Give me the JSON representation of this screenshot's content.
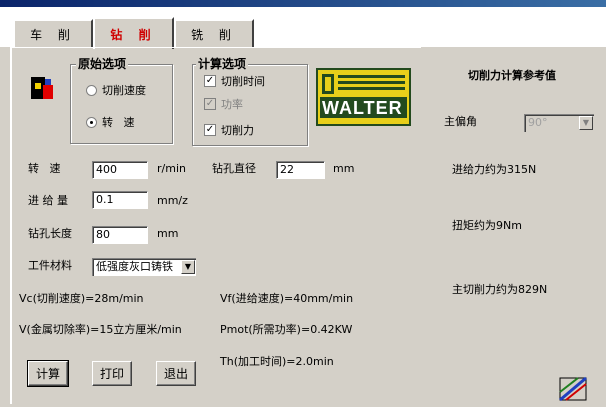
{
  "tabs": [
    {
      "label": "车 削"
    },
    {
      "label": "钻 削"
    },
    {
      "label": "铣 削"
    }
  ],
  "original_options": {
    "title": "原始选项",
    "radio1": "切削速度",
    "radio2": "转   速"
  },
  "calc_options": {
    "title": "计算选项",
    "check1": "切削时间",
    "check2": "功率",
    "check3": "切削力"
  },
  "logo_text": "WALTER",
  "fields": {
    "speed_label": "转   速",
    "speed_value": "400",
    "speed_unit": "r/min",
    "feed_label": "进 给 量",
    "feed_value": "0.1",
    "feed_unit": "mm/z",
    "depth_label": "钻孔长度",
    "depth_value": "80",
    "depth_unit": "mm",
    "diameter_label": "钻孔直径",
    "diameter_value": "22",
    "diameter_unit": "mm",
    "material_label": "工件材料",
    "material_value": "低强度灰口铸铁"
  },
  "results": {
    "vc": "Vc(切削速度)=28m/min",
    "vf": "Vf(进给速度)=40mm/min",
    "v": "V(金属切除率)=15立方厘米/min",
    "pmot": "Pmot(所需功率)=0.42KW",
    "th": "Th(加工时间)=2.0min"
  },
  "buttons": {
    "calc": "计算",
    "print": "打印",
    "exit": "退出"
  },
  "reference": {
    "title": "切削力计算参考值",
    "angle_label": "主偏角",
    "angle_value": "90°",
    "feed_force": "进给力约为315N",
    "torque": "扭矩约为9Nm",
    "main_force": "主切削力约为829N"
  },
  "colors": {
    "active_tab": "#d00000",
    "logo_bg": "#e8cf1a",
    "logo_dark": "#234a1e"
  }
}
